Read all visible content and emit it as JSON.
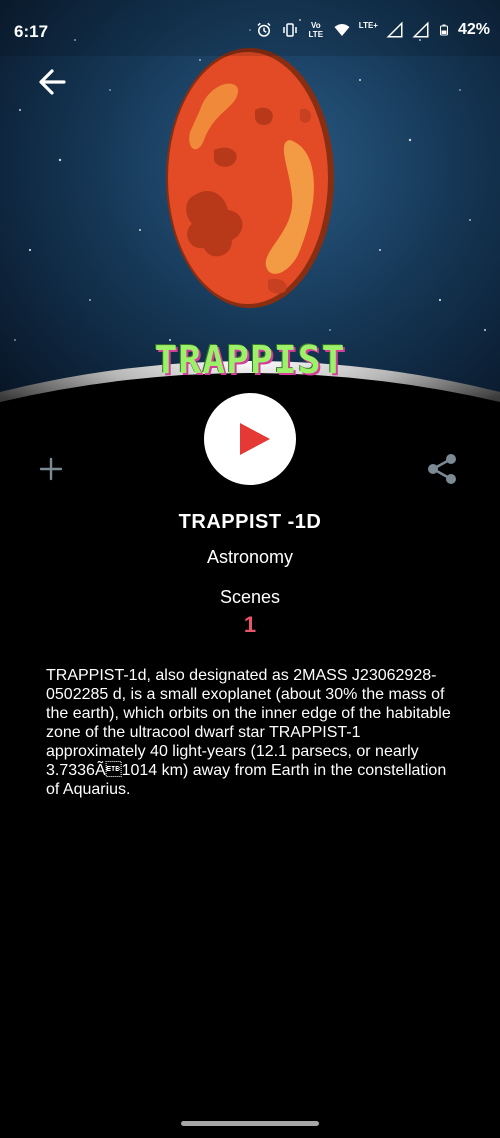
{
  "status_bar": {
    "time": "6:17",
    "network_label": "Vo LTE",
    "lte_label": "LTE+",
    "battery": "42%"
  },
  "hero": {
    "logo_text": "TRAPPIST",
    "background_color": "#0b1f3a",
    "planet_color": "#e24b25",
    "logo_color": "#9df06a"
  },
  "content": {
    "title": "TRAPPIST -1D",
    "category": "Astronomy",
    "scenes_label": "Scenes",
    "scenes_count": "1",
    "description": "TRAPPIST-1d, also designated as 2MASS J23062928-0502285 d, is a small exoplanet (about 30% the mass of the earth), which orbits on the inner edge of the habitable zone of the ultracool dwarf star TRAPPIST-1 approximately 40 light-years (12.1 parsecs, or nearly 3.7336Ã\u00171014 km) away from Earth in the constellation of Aquarius."
  },
  "colors": {
    "accent": "#e9546b",
    "play_icon": "#e53935",
    "icon_grey": "#7c8a94"
  }
}
